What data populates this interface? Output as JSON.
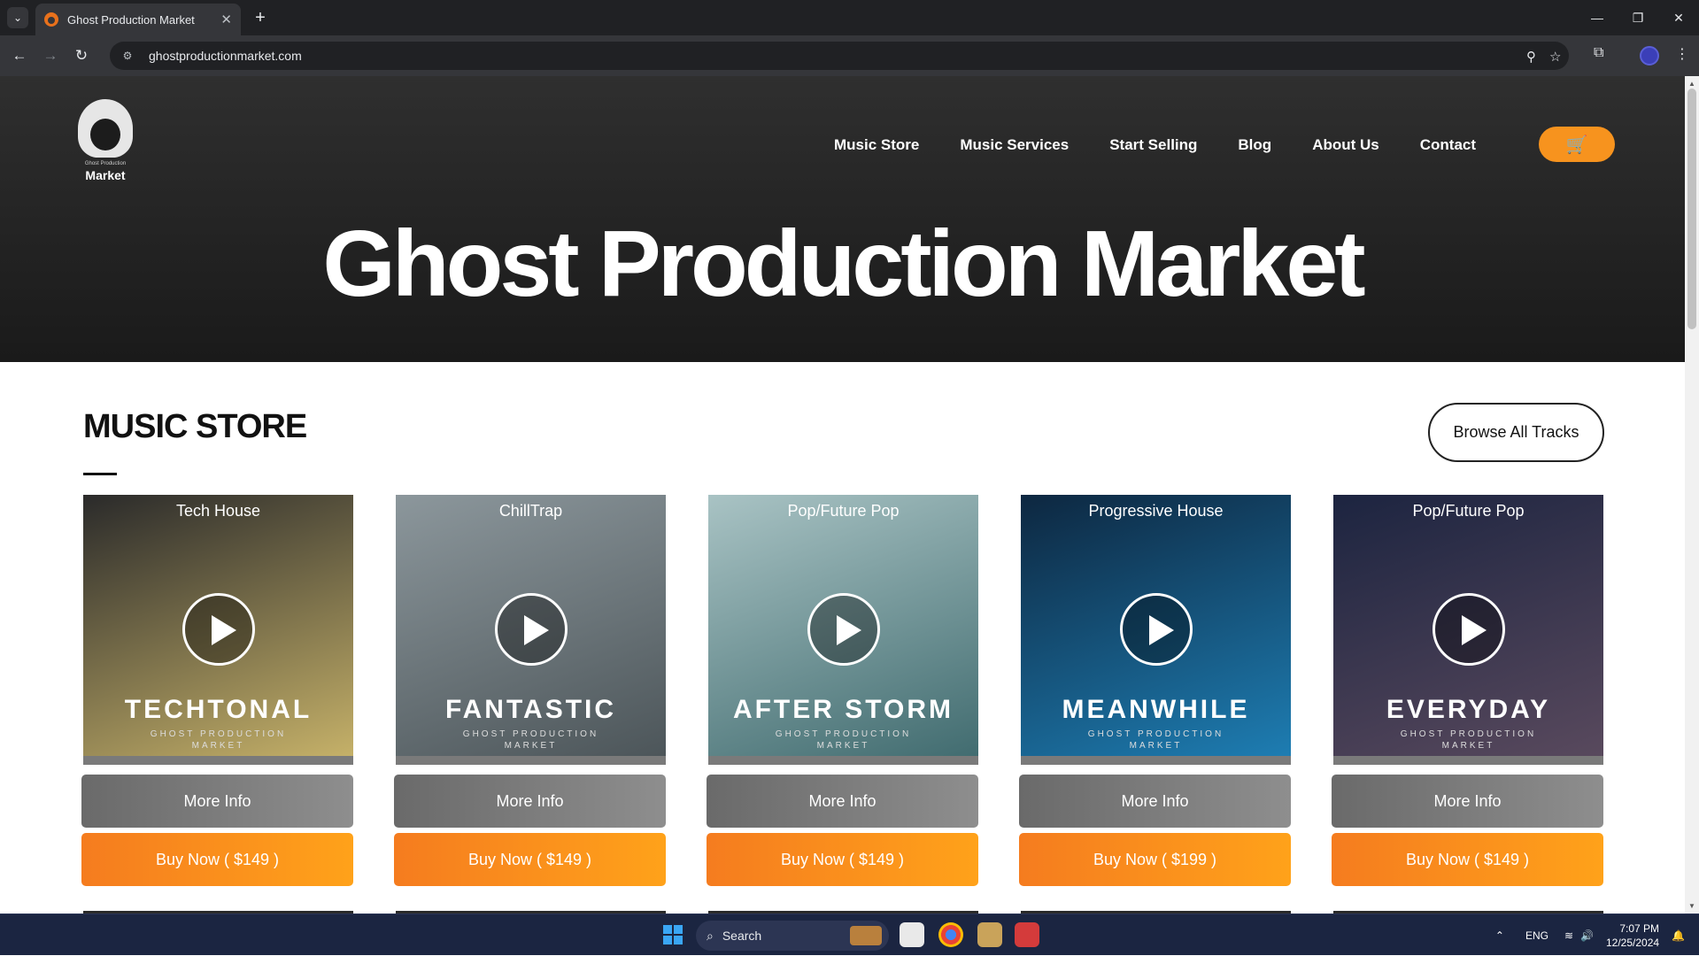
{
  "browser": {
    "tab_title": "Ghost Production Market",
    "tab_close": "✕",
    "new_tab": "+",
    "url": "ghostproductionmarket.com",
    "window_buttons": [
      "—",
      "❐",
      "✕"
    ]
  },
  "site": {
    "logo_small": "Ghost Production",
    "logo_text": "Market",
    "nav": [
      "Music Store",
      "Music Services",
      "Start Selling",
      "Blog",
      "About Us",
      "Contact"
    ],
    "cart_icon": "🛒",
    "hero_title": "Ghost Production Market"
  },
  "store": {
    "title": "MUSIC STORE",
    "browse_label": "Browse All Tracks",
    "tracks": [
      {
        "genre": "Tech House",
        "name": "TECHTONAL",
        "subtitle": "GHOST PRODUCTION\nMARKET",
        "more_label": "More Info",
        "buy_label": "Buy Now ( $149 )",
        "color_top": "#2a2a2a",
        "color_bottom": "#c9b46a"
      },
      {
        "genre": "ChillTrap",
        "name": "FANTASTIC",
        "subtitle": "GHOST PRODUCTION\nMARKET",
        "more_label": "More Info",
        "buy_label": "Buy Now ( $149 )",
        "color_top": "#8c979c",
        "color_bottom": "#4b5458"
      },
      {
        "genre": "Pop/Future Pop",
        "name": "AFTER STORM",
        "subtitle": "GHOST PRODUCTION\nMARKET",
        "more_label": "More Info",
        "buy_label": "Buy Now ( $149 )",
        "color_top": "#a9c3c4",
        "color_bottom": "#3f6a6e"
      },
      {
        "genre": "Progressive House",
        "name": "MEANWHILE",
        "subtitle": "GHOST PRODUCTION\nMARKET",
        "more_label": "More Info",
        "buy_label": "Buy Now ( $199 )",
        "color_top": "#0d2740",
        "color_bottom": "#1e7fb5"
      },
      {
        "genre": "Pop/Future Pop",
        "name": "EVERYDAY",
        "subtitle": "GHOST PRODUCTION\nMARKET",
        "more_label": "More Info",
        "buy_label": "Buy Now ( $149 )",
        "color_top": "#1c2440",
        "color_bottom": "#5a4a5e"
      }
    ]
  },
  "taskbar": {
    "search_placeholder": "Search",
    "language": "ENG",
    "time": "7:07 PM",
    "date": "12/25/2024"
  },
  "colors": {
    "accent_orange": "#f7931e",
    "hero_bg": "#1a1a1a"
  }
}
